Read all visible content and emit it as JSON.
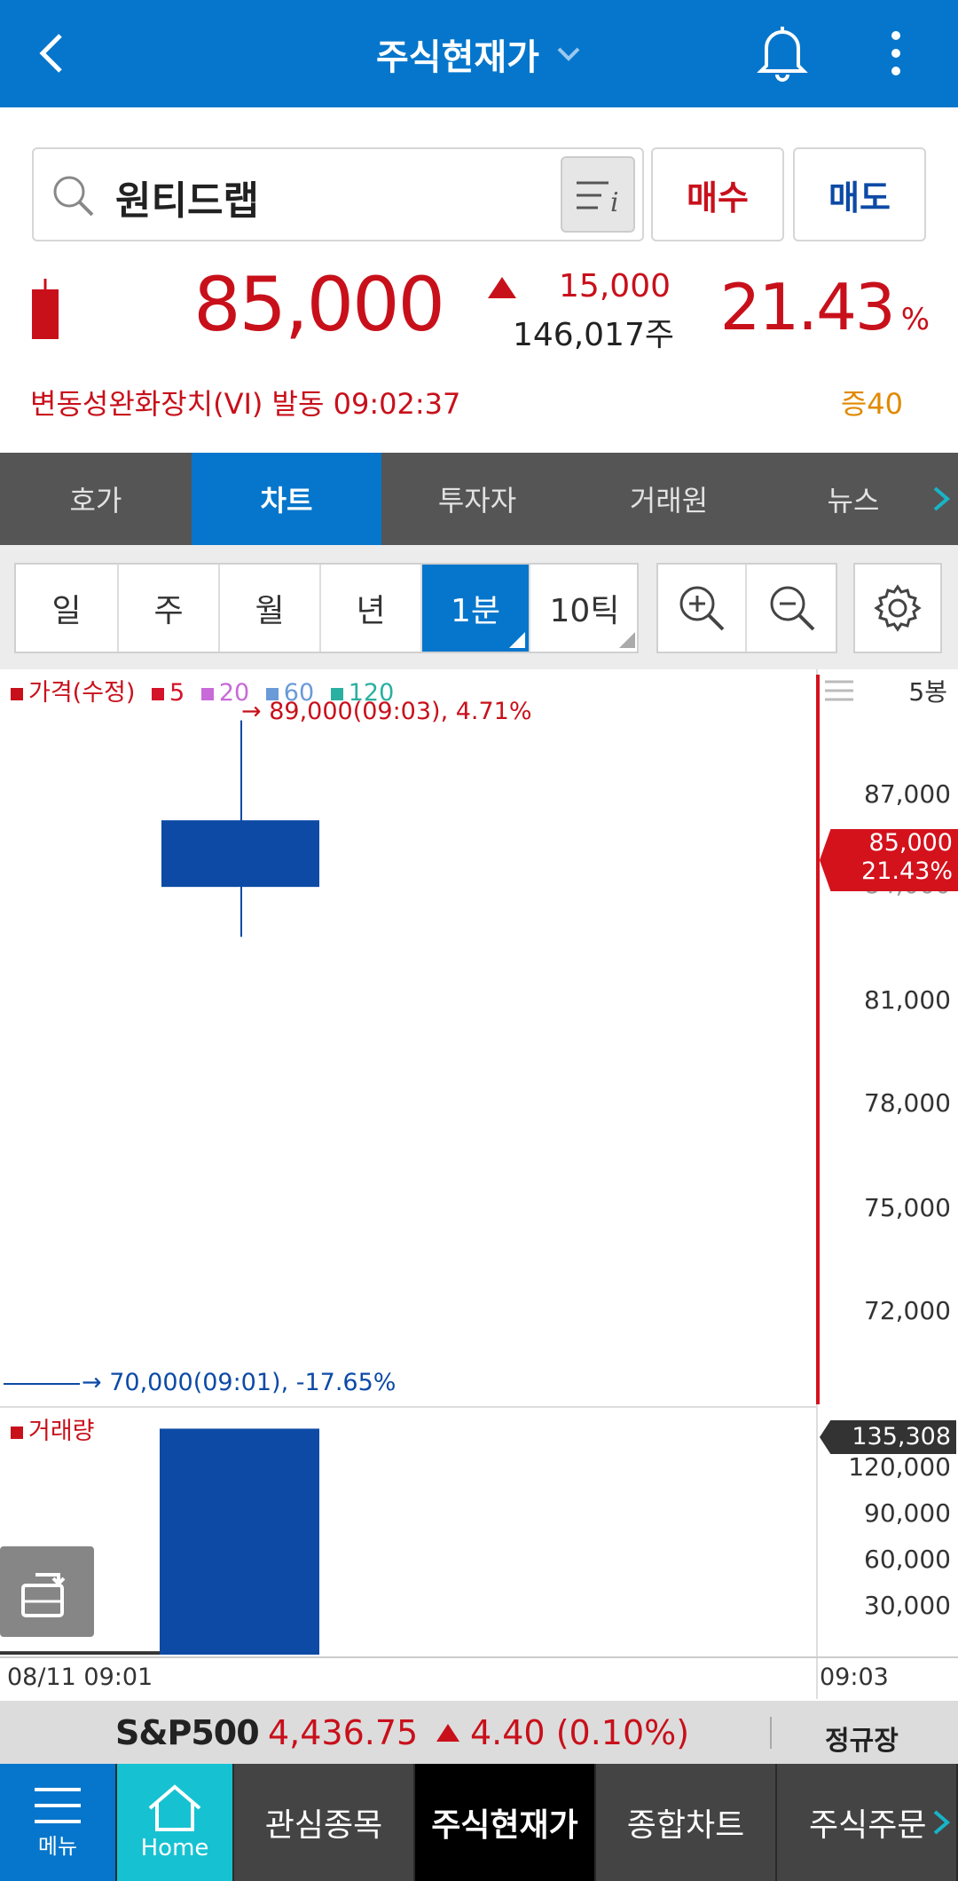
{
  "header": {
    "title": "주식현재가"
  },
  "search": {
    "stock_name": "원티드랩",
    "buy_label": "매수",
    "sell_label": "매도"
  },
  "quote": {
    "price": "85,000",
    "change": "15,000",
    "volume": "146,017주",
    "rate": "21.43",
    "rate_unit": "%",
    "vi_notice": "변동성완화장치(VI) 발동 09:02:37",
    "margin": "증40",
    "colors": {
      "up": "#c8101b",
      "down": "#0c4aa6"
    }
  },
  "tabs": [
    "호가",
    "차트",
    "투자자",
    "거래원",
    "뉴스"
  ],
  "periods": [
    "일",
    "주",
    "월",
    "년",
    "1분",
    "10틱"
  ],
  "chart": {
    "legend": {
      "price": "가격(수정)",
      "ma5": "5",
      "ma20": "20",
      "ma60": "60",
      "ma120": "120"
    },
    "bar_count": "5봉",
    "high_annot": "89,000(09:03), 4.71%",
    "low_annot": "70,000(09:01), -17.65%",
    "price_ticks": [
      "87,000",
      "84,000",
      "81,000",
      "78,000",
      "75,000",
      "72,000"
    ],
    "cur_price": "85,000",
    "cur_rate": "21.43%",
    "volume_label": "거래량",
    "volume_ticks": [
      "120,000",
      "90,000",
      "60,000",
      "30,000"
    ],
    "cur_volume": "135,308",
    "x_start": "08/11 09:01",
    "x_end": "09:03"
  },
  "chart_data": {
    "type": "candlestick",
    "x": [
      "09:01",
      "09:02",
      "09:03"
    ],
    "candles": [
      {
        "time": "09:02",
        "open": 86000,
        "high": 89000,
        "low": 82500,
        "close": 84000
      }
    ],
    "volume": [
      {
        "time": "09:01",
        "value": 2000
      },
      {
        "time": "09:02",
        "value": 132000
      }
    ],
    "ylim": [
      69000,
      90000
    ],
    "volume_ylim": [
      0,
      140000
    ]
  },
  "index": {
    "name": "S&P500",
    "value": "4,436.75",
    "change": "4.40 (0.10%)",
    "session": "정규장"
  },
  "nav": {
    "menu": "메뉴",
    "home": "Home",
    "items": [
      "관심종목",
      "주식현재가",
      "종합차트",
      "주식주문"
    ]
  }
}
